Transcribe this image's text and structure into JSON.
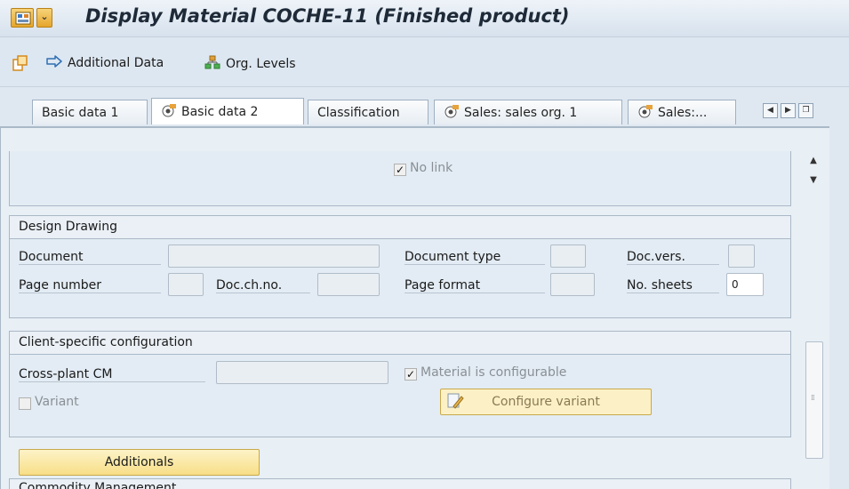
{
  "window": {
    "title": "Display Material COCHE-11 (Finished product)",
    "menu_arrow": "⌄"
  },
  "toolbar": {
    "additional_data": "Additional Data",
    "org_levels": "Org. Levels"
  },
  "tabs": [
    {
      "label": "Basic data 1",
      "active": false,
      "icon": false
    },
    {
      "label": "Basic data 2",
      "active": true,
      "icon": true
    },
    {
      "label": "Classification",
      "active": false,
      "icon": false
    },
    {
      "label": "Sales: sales org. 1",
      "active": false,
      "icon": true
    },
    {
      "label": "Sales:...",
      "active": false,
      "icon": true
    }
  ],
  "top_section": {
    "no_link_label": "No link",
    "no_link_checked": true
  },
  "design_drawing": {
    "title": "Design Drawing",
    "document_label": "Document",
    "document_value": "",
    "document_type_label": "Document type",
    "document_type_value": "",
    "doc_vers_label": "Doc.vers.",
    "doc_vers_value": "",
    "page_number_label": "Page number",
    "page_number_value": "",
    "doc_ch_no_label": "Doc.ch.no.",
    "doc_ch_no_value": "",
    "page_format_label": "Page format",
    "page_format_value": "",
    "no_sheets_label": "No. sheets",
    "no_sheets_value": "0"
  },
  "client_config": {
    "title": "Client-specific configuration",
    "cross_plant_label": "Cross-plant CM",
    "cross_plant_value": "",
    "material_configurable_label": "Material is configurable",
    "material_configurable_checked": true,
    "variant_label": "Variant",
    "variant_checked": false,
    "configure_variant_label": "Configure variant"
  },
  "additionals_label": "Additionals",
  "commodity_title": "Commodity Management",
  "colors": {
    "accent_yellow": "#f7de86",
    "panel_bg": "#e8eff5",
    "title_text": "#1e2a38"
  }
}
